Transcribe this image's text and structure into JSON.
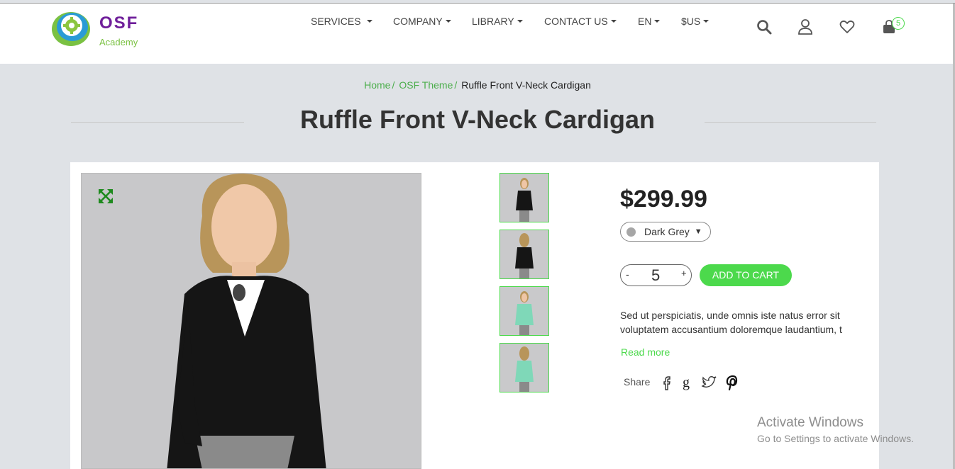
{
  "logo": {
    "title": "OSF",
    "subtitle": "Academy"
  },
  "nav": {
    "services": "SERVICES",
    "company": "COMPANY",
    "library": "LIBRARY",
    "contact": "CONTACT US",
    "language": "EN",
    "currency": "$US"
  },
  "header_icons": {
    "search": "search-icon",
    "account": "user-icon",
    "wishlist": "heart-icon",
    "cart": "shopping-bag-icon",
    "cart_count": "5"
  },
  "breadcrumb": {
    "home": "Home",
    "category": "OSF Theme",
    "current": "Ruffle Front V-Neck Cardigan",
    "separator": "/"
  },
  "page_title": "Ruffle Front V-Neck Cardigan",
  "product": {
    "price": "$299.99",
    "color_selected": "Dark Grey",
    "color_swatch": "#a6a6a6",
    "quantity": "5",
    "minus": "-",
    "plus": "+",
    "add_to_cart": "ADD TO CART",
    "description_line1": "Sed ut perspiciatis, unde omnis iste natus error sit",
    "description_line2": "voluptatem accusantium doloremque laudantium, t",
    "read_more": "Read more",
    "share_label": "Share",
    "thumbnails": [
      "black-cardigan-front",
      "black-cardigan-back",
      "mint-cardigan-front",
      "mint-cardigan-back"
    ]
  },
  "colors": {
    "accent": "#4cd94c",
    "brand": "#6f1f9a",
    "link": "#4cae4c"
  },
  "watermark": {
    "line1": "Activate Windows",
    "line2": "Go to Settings to activate Windows."
  }
}
